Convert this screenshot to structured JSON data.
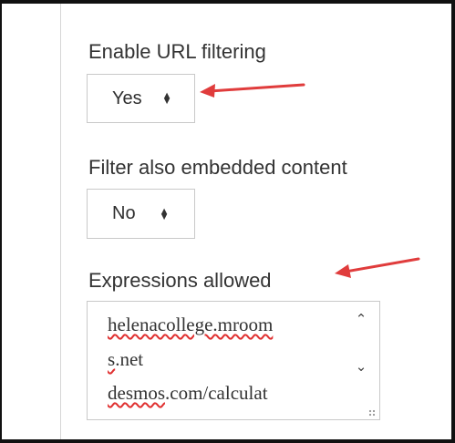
{
  "form": {
    "url_filtering": {
      "label": "Enable URL filtering",
      "value": "Yes"
    },
    "embedded_content": {
      "label": "Filter also embedded content",
      "value": "No"
    },
    "expressions": {
      "label": "Expressions allowed",
      "lines": [
        "helenacollege.mroom",
        "s.net",
        "desmos.com/calculat"
      ]
    }
  },
  "colors": {
    "annotation_arrow": "#e03c3c",
    "label_text": "#333333",
    "spellcheck_underline": "#e03030"
  },
  "icons": {
    "select_arrows": "up-down-caret",
    "scroll_up": "chevron-up-icon",
    "scroll_down": "chevron-down-icon"
  }
}
